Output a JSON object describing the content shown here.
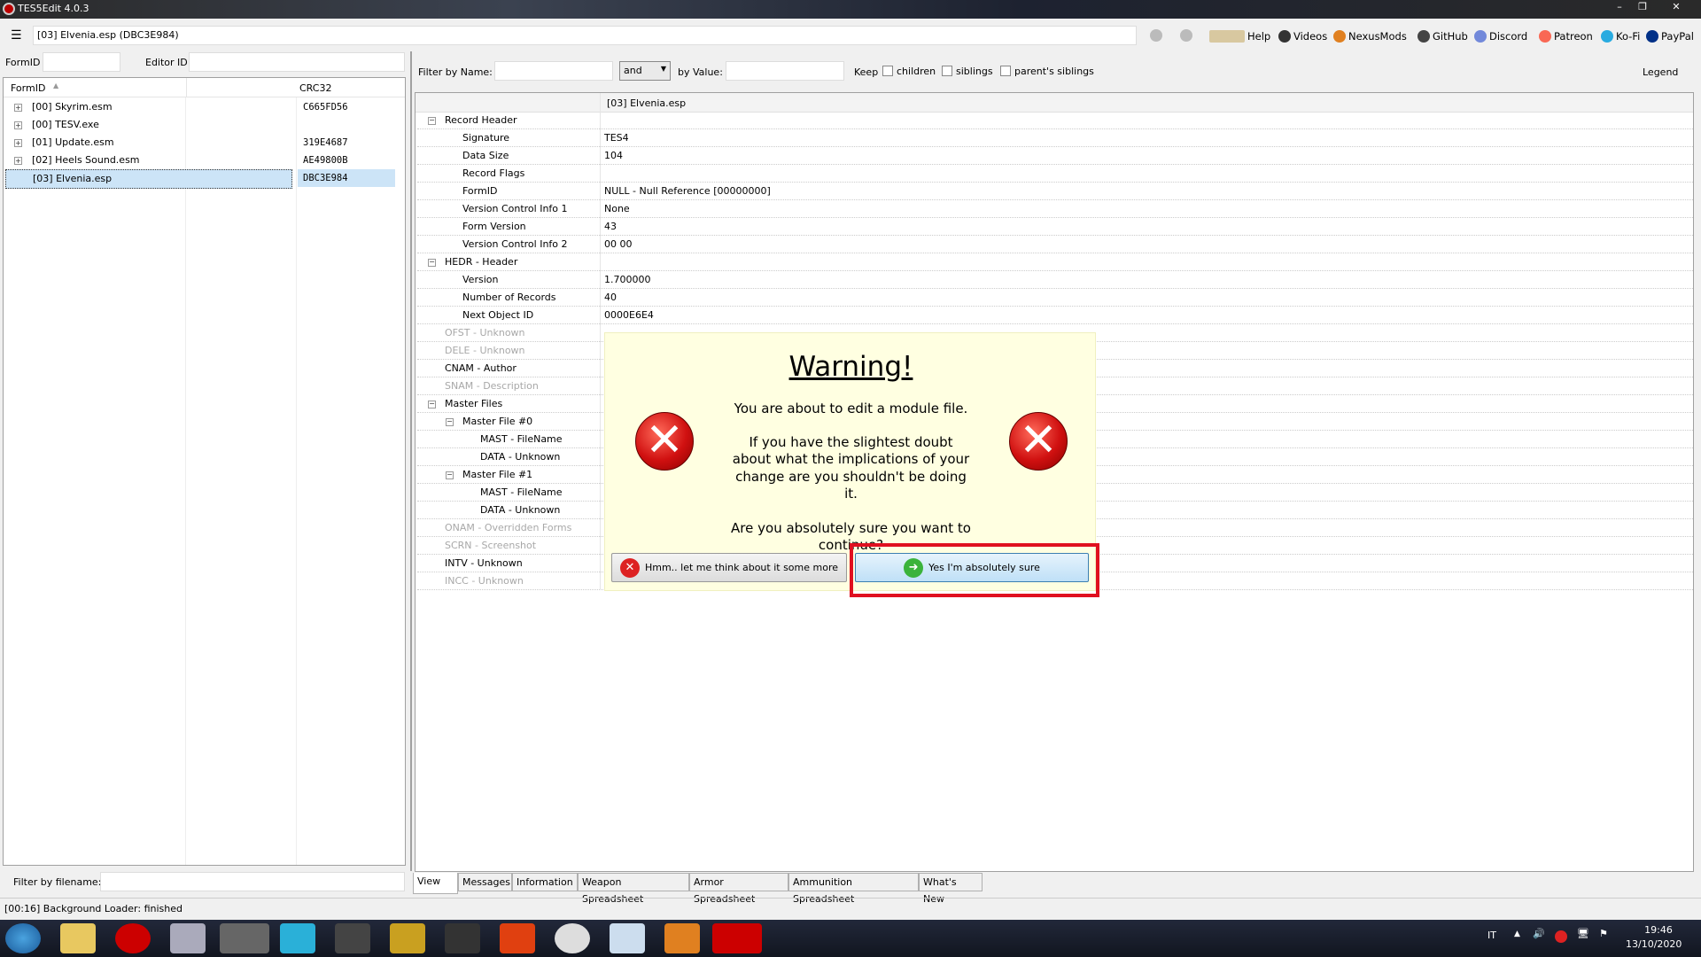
{
  "window": {
    "title": "TES5Edit 4.0.3",
    "breadcrumb": "[03] Elvenia.esp (DBC3E984)"
  },
  "toolbar": {
    "links": [
      {
        "label": "Help",
        "icon": "book-icon"
      },
      {
        "label": "Videos",
        "icon": "gp-icon"
      },
      {
        "label": "NexusMods",
        "icon": "nexusmods-icon"
      },
      {
        "label": "GitHub",
        "icon": "github-icon"
      },
      {
        "label": "Discord",
        "icon": "discord-icon"
      },
      {
        "label": "Patreon",
        "icon": "patreon-icon"
      },
      {
        "label": "Ko-Fi",
        "icon": "kofi-icon"
      },
      {
        "label": "PayPal",
        "icon": "paypal-icon"
      }
    ]
  },
  "left": {
    "formid_label": "FormID",
    "editorid_label": "Editor ID",
    "col_formid": "FormID",
    "col_crc": "CRC32",
    "files": [
      {
        "name": "[00] Skyrim.esm",
        "crc": "C665FD56"
      },
      {
        "name": "[00] TESV.exe",
        "crc": ""
      },
      {
        "name": "[01] Update.esm",
        "crc": "319E4687"
      },
      {
        "name": "[02] Heels Sound.esm",
        "crc": "AE49800B"
      },
      {
        "name": "[03] Elvenia.esp",
        "crc": "DBC3E984",
        "selected": true
      }
    ],
    "filter_label": "Filter by filename:"
  },
  "filter": {
    "name_label": "Filter by Name:",
    "operator": "and",
    "value_label": "by Value:",
    "keep_label": "Keep",
    "children": "children",
    "siblings": "siblings",
    "parents_siblings": "parent's siblings",
    "legend": "Legend"
  },
  "grid": {
    "header": "[03] Elvenia.esp",
    "rows": [
      {
        "name": "Record Header",
        "value": "",
        "level": 0,
        "expand": true
      },
      {
        "name": "Signature",
        "value": "TES4",
        "level": 1
      },
      {
        "name": "Data Size",
        "value": "104",
        "level": 1
      },
      {
        "name": "Record Flags",
        "value": "",
        "level": 1
      },
      {
        "name": "FormID",
        "value": "NULL - Null Reference [00000000]",
        "level": 1
      },
      {
        "name": "Version Control Info 1",
        "value": "None",
        "level": 1
      },
      {
        "name": "Form Version",
        "value": "43",
        "level": 1
      },
      {
        "name": "Version Control Info 2",
        "value": "00 00",
        "level": 1
      },
      {
        "name": "HEDR - Header",
        "value": "",
        "level": 0,
        "expand": true
      },
      {
        "name": "Version",
        "value": "1.700000",
        "level": 1
      },
      {
        "name": "Number of Records",
        "value": "40",
        "level": 1
      },
      {
        "name": "Next Object ID",
        "value": "0000E6E4",
        "level": 1
      },
      {
        "name": "OFST - Unknown",
        "value": "",
        "level": 0,
        "gray": true
      },
      {
        "name": "DELE - Unknown",
        "value": "",
        "level": 0,
        "gray": true
      },
      {
        "name": "CNAM - Author",
        "value": "",
        "level": 0
      },
      {
        "name": "SNAM - Description",
        "value": "",
        "level": 0,
        "gray": true
      },
      {
        "name": "Master Files",
        "value": "",
        "level": 0,
        "expand": true
      },
      {
        "name": "Master File #0",
        "value": "",
        "level": 1,
        "expand": true
      },
      {
        "name": "MAST - FileName",
        "value": "",
        "level": 2
      },
      {
        "name": "DATA - Unknown",
        "value": "",
        "level": 2
      },
      {
        "name": "Master File #1",
        "value": "",
        "level": 1,
        "expand": true
      },
      {
        "name": "MAST - FileName",
        "value": "",
        "level": 2
      },
      {
        "name": "DATA - Unknown",
        "value": "",
        "level": 2
      },
      {
        "name": "ONAM - Overridden Forms",
        "value": "",
        "level": 0,
        "gray": true
      },
      {
        "name": "SCRN - Screenshot",
        "value": "",
        "level": 0,
        "gray": true
      },
      {
        "name": "INTV - Unknown",
        "value": "",
        "level": 0
      },
      {
        "name": "INCC - Unknown",
        "value": "",
        "level": 0,
        "gray": true
      }
    ]
  },
  "tabs": [
    "View",
    "Messages",
    "Information",
    "Weapon Spreadsheet",
    "Armor Spreadsheet",
    "Ammunition Spreadsheet",
    "What's New"
  ],
  "status": "[00:16] Background Loader: finished",
  "dialog": {
    "title": "Warning!",
    "line1": "You are about to edit a module file.",
    "line2": "If you have the slightest doubt about what the implications of your change are you shouldn't be doing it.",
    "line3": "Are you absolutely sure you want to continue?",
    "cancel": "Hmm.. let me think about it some more",
    "confirm": "Yes I'm absolutely sure",
    "highlight_color": "#e01020"
  },
  "tray": {
    "lang": "IT",
    "time": "19:46",
    "date": "13/10/2020"
  }
}
